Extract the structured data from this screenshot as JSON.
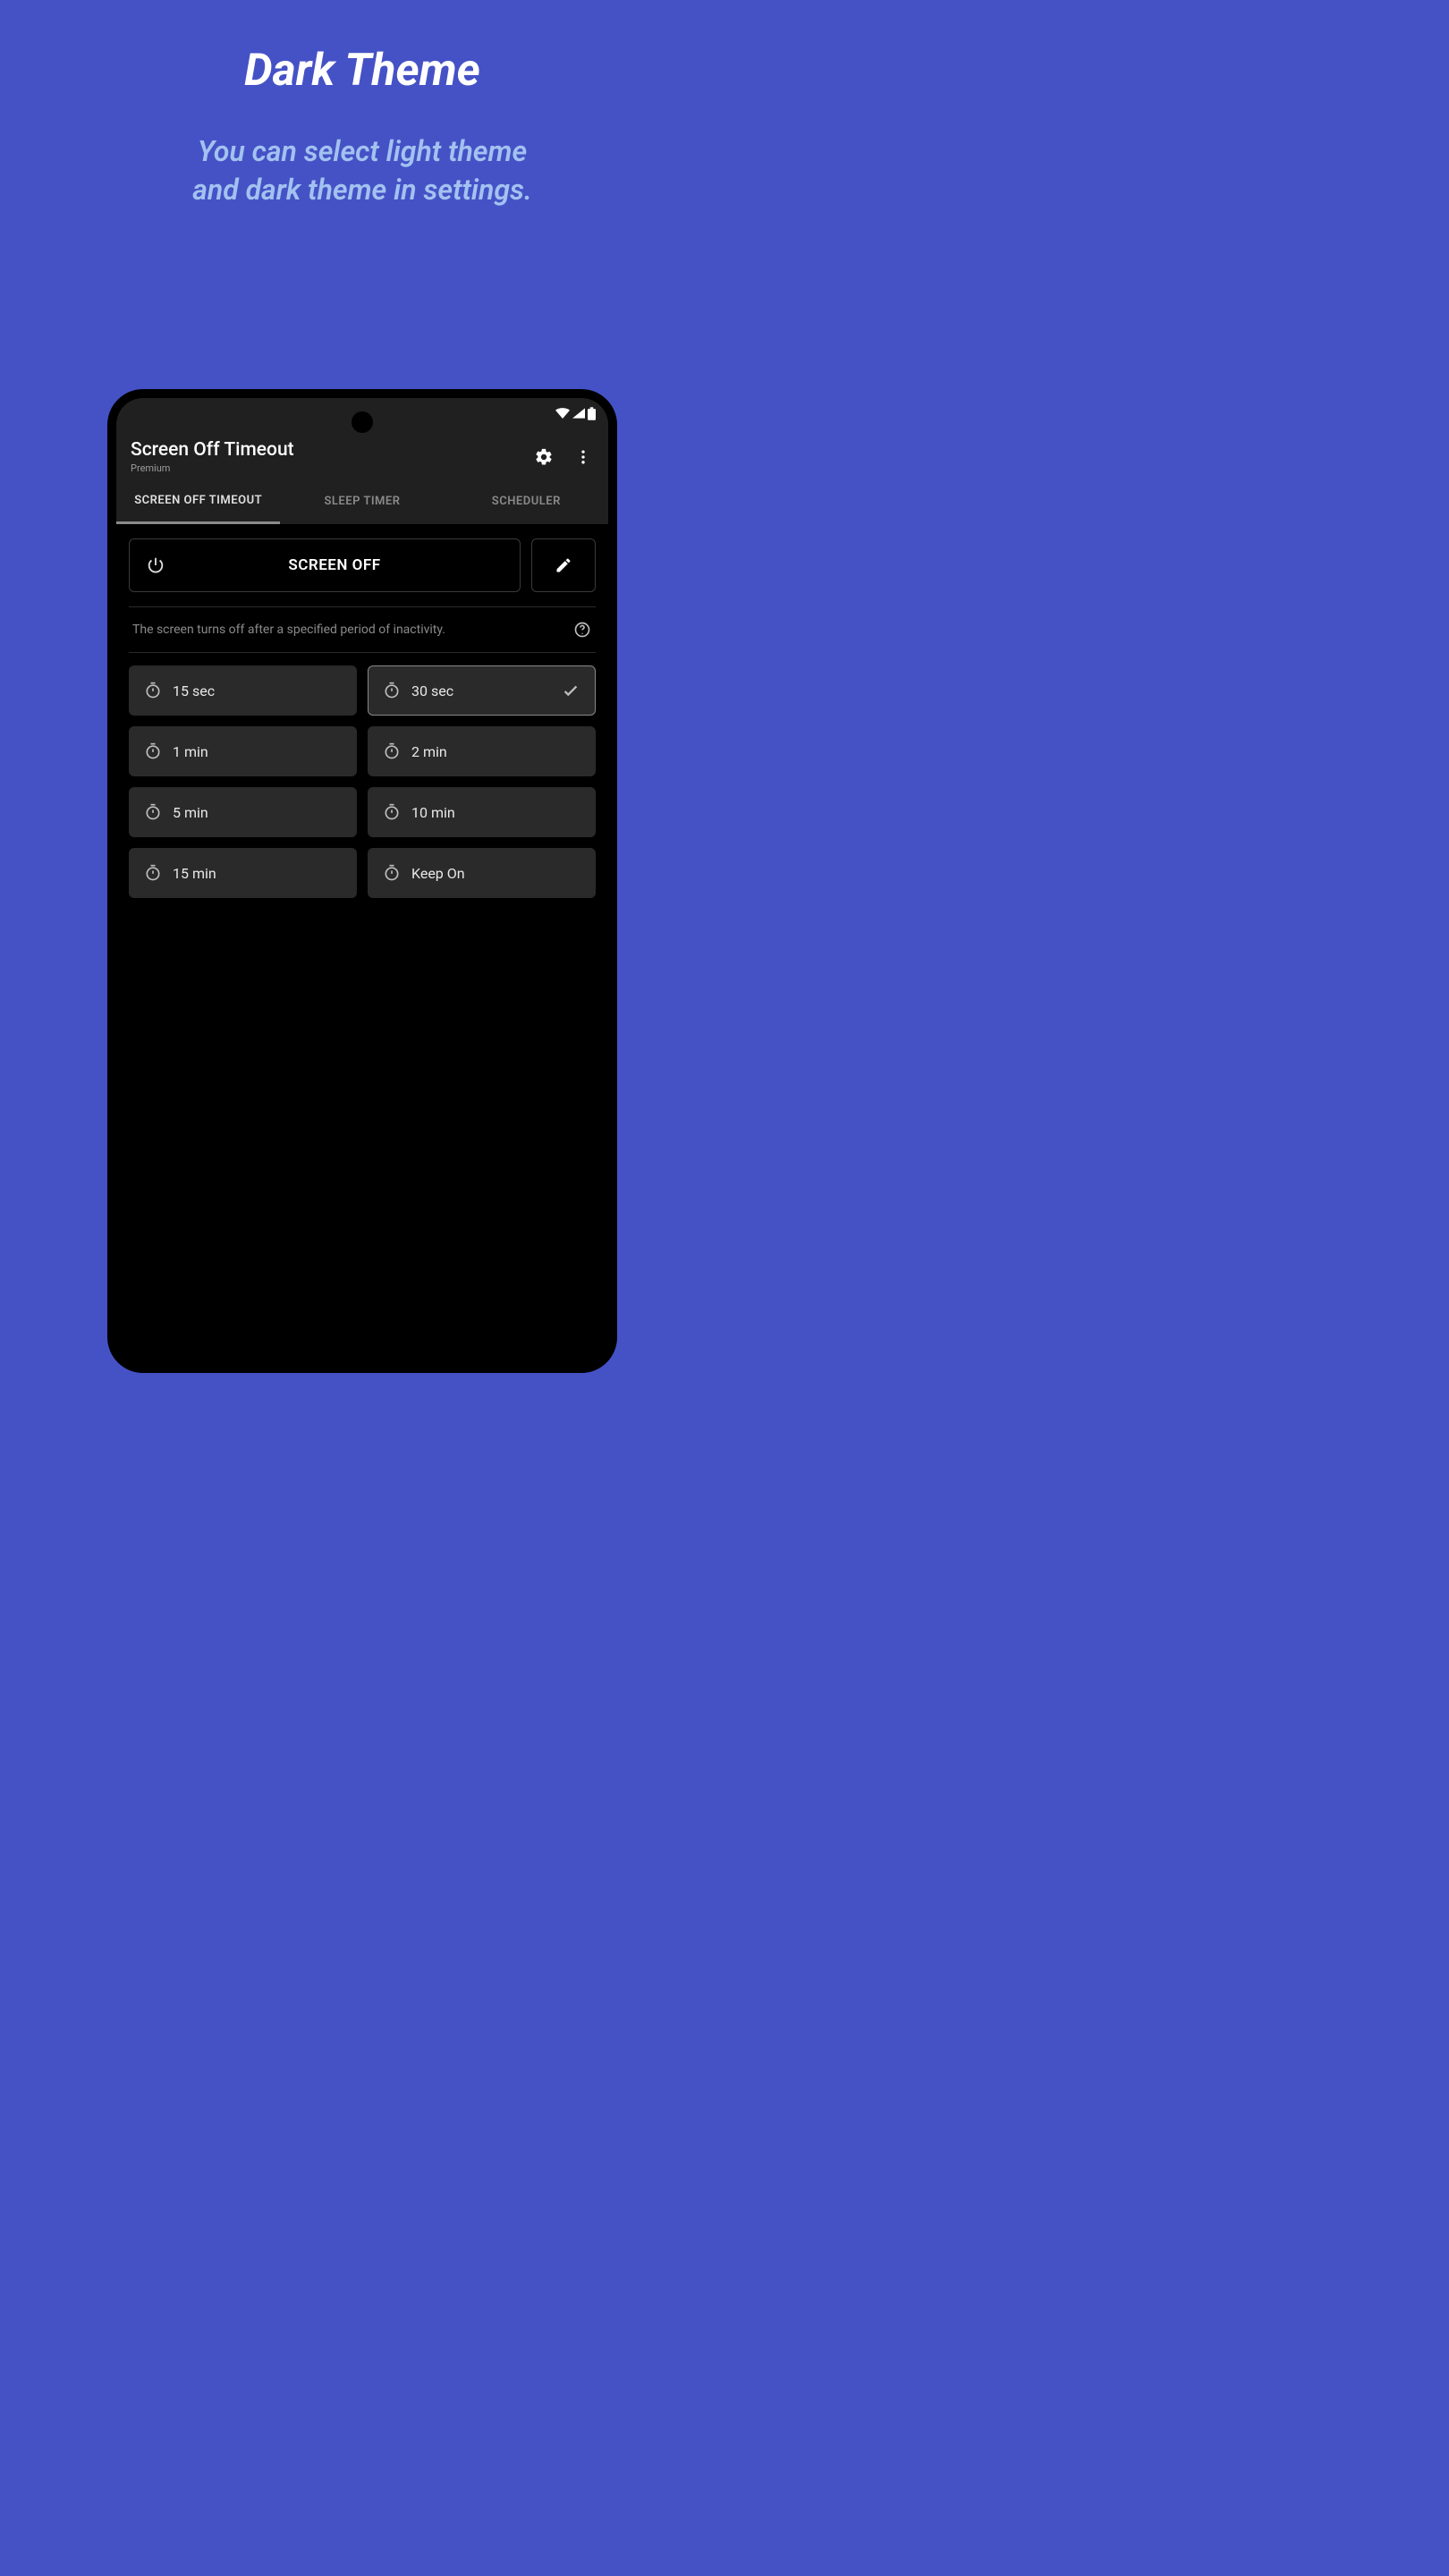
{
  "promo": {
    "title": "Dark Theme",
    "subtitle_line1": "You can select light theme",
    "subtitle_line2": "and dark theme in settings."
  },
  "app": {
    "title": "Screen Off Timeout",
    "subtitle": "Premium"
  },
  "tabs": [
    {
      "label": "SCREEN OFF TIMEOUT",
      "active": true
    },
    {
      "label": "SLEEP TIMER",
      "active": false
    },
    {
      "label": "SCHEDULER",
      "active": false
    }
  ],
  "main": {
    "screen_off_label": "SCREEN OFF",
    "description": "The screen turns off after a specified period of inactivity."
  },
  "options": [
    {
      "label": "15 sec",
      "selected": false
    },
    {
      "label": "30 sec",
      "selected": true
    },
    {
      "label": "1 min",
      "selected": false
    },
    {
      "label": "2 min",
      "selected": false
    },
    {
      "label": "5 min",
      "selected": false
    },
    {
      "label": "10 min",
      "selected": false
    },
    {
      "label": "15 min",
      "selected": false
    },
    {
      "label": "Keep On",
      "selected": false
    }
  ]
}
